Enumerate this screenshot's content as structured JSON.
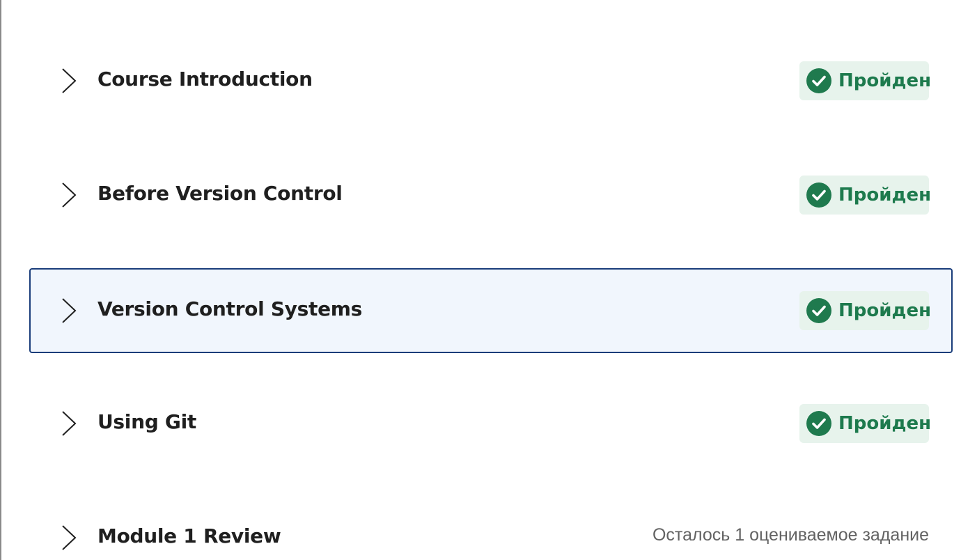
{
  "modules": [
    {
      "title": "Course Introduction",
      "status": "Пройден",
      "completed": true,
      "selected": false
    },
    {
      "title": "Before Version Control",
      "status": "Пройден",
      "completed": true,
      "selected": false
    },
    {
      "title": "Version Control Systems",
      "status": "Пройден",
      "completed": true,
      "selected": true
    },
    {
      "title": "Using Git",
      "status": "Пройден",
      "completed": true,
      "selected": false
    },
    {
      "title": "Module 1 Review",
      "status": "Осталось 1 оцениваемое задание",
      "completed": false,
      "selected": false
    }
  ],
  "colors": {
    "completed_text": "#1d7a4d",
    "completed_bg": "#e7f3ec",
    "check_circle": "#1f7a4e",
    "selected_bg": "#f1f6fd",
    "selected_border": "#1a3d7a"
  },
  "icons": {
    "expand": "chevron-right-icon",
    "completed": "check-circle-icon"
  }
}
